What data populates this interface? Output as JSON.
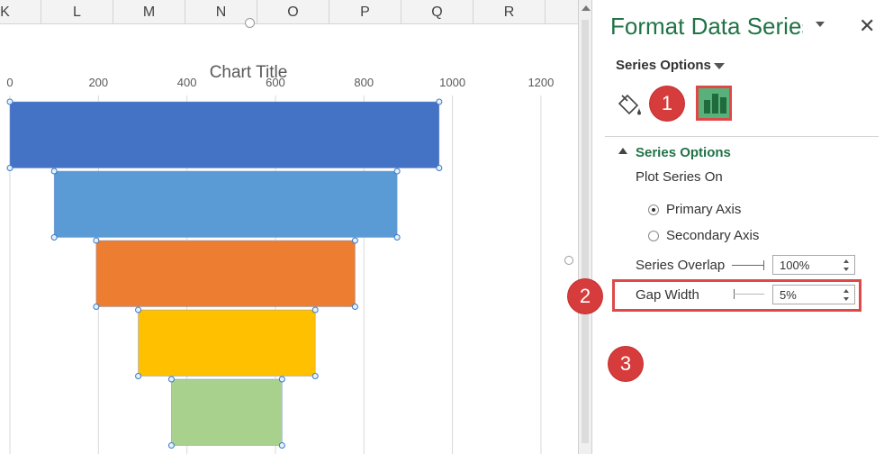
{
  "sheet": {
    "columns": [
      "K",
      "L",
      "M",
      "N",
      "O",
      "P",
      "Q",
      "R"
    ]
  },
  "chart": {
    "title": "Chart Title"
  },
  "chart_data": {
    "type": "bar",
    "title": "Chart Title",
    "xlim": [
      0,
      1200
    ],
    "x_ticks": [
      "0",
      "200",
      "400",
      "600",
      "800",
      "1000",
      "1200"
    ],
    "grid": true,
    "stacked_offsets": [
      0,
      100,
      195,
      290,
      365
    ],
    "values": [
      970,
      775,
      585,
      400,
      250
    ],
    "colors": [
      "#4472c4",
      "#5b9bd5",
      "#ed7d31",
      "#ffc000",
      "#a9d18e"
    ]
  },
  "pane": {
    "title": "Format Data Series",
    "options_dropdown": "Series Options",
    "section_label": "Series Options",
    "plot_series_on": "Plot Series On",
    "primary_axis": "Primary Axis",
    "secondary_axis": "Secondary Axis",
    "series_overlap_label": "Series Overlap",
    "series_overlap_value": "100%",
    "gap_width_label": "Gap Width",
    "gap_width_value": "5%",
    "selected_axis": "primary"
  },
  "badges": [
    "1",
    "2",
    "3"
  ],
  "icons": {
    "fill": "paint-bucket-icon",
    "series_options": "bar-chart-icon",
    "close": "close-icon"
  },
  "colors": {
    "accent": "#217346",
    "badge": "#d63c3c",
    "highlight": "#e04848"
  }
}
